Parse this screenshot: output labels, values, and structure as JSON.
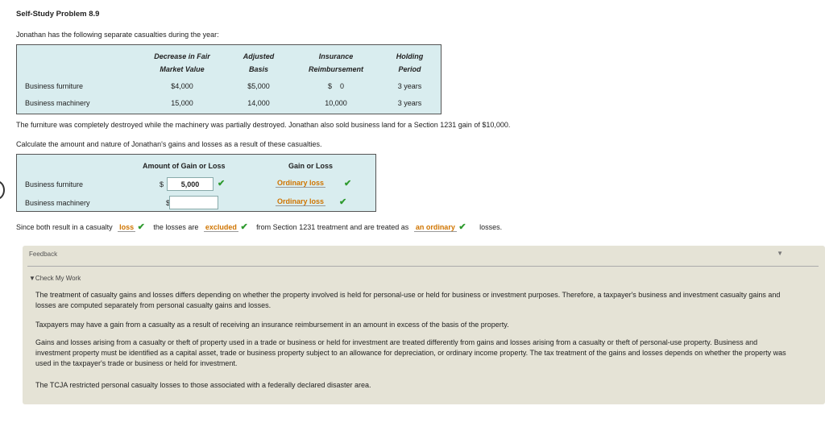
{
  "title": "Self-Study Problem 8.9",
  "intro": "Jonathan has the following separate casualties during the year:",
  "table1": {
    "headers": {
      "decrease_line1": "Decrease in Fair",
      "decrease_line2": "Market Value",
      "adjusted_line1": "Adjusted",
      "adjusted_line2": "Basis",
      "insurance_line1": "Insurance",
      "insurance_line2": "Reimbursement",
      "holding_line1": "Holding",
      "holding_line2": "Period"
    },
    "rows": [
      {
        "label": "Business furniture",
        "decrease": "$4,000",
        "basis": "$5,000",
        "insurance": "$    0",
        "holding": "3 years"
      },
      {
        "label": "Business machinery",
        "decrease": "15,000",
        "basis": "14,000",
        "insurance": "10,000",
        "holding": "3 years"
      }
    ]
  },
  "statement": "The furniture was completely destroyed while the machinery was partially destroyed. Jonathan also sold business land for a Section 1231 gain of $10,000.",
  "instruction": "Calculate the amount and nature of Jonathan's gains and losses as a result of these casualties.",
  "table2": {
    "header_amount": "Amount of Gain or Loss",
    "header_gain": "Gain or Loss",
    "rows": [
      {
        "label": "Business furniture",
        "dollar": "$",
        "value": "5,000",
        "check": "✔",
        "nature": "Ordinary loss",
        "nature_check": "✔"
      },
      {
        "label": "Business machinery",
        "dollar": "$",
        "value": "",
        "check": "",
        "nature": "Ordinary loss",
        "nature_check": "✔"
      }
    ]
  },
  "sentence": {
    "part1": "Since both result in a casualty",
    "choice1": "loss",
    "part2": "the losses are",
    "choice2": "excluded",
    "part3": "from Section 1231 treatment and are treated as",
    "choice3": "an ordinary",
    "part4": "losses.",
    "check": "✔"
  },
  "feedback": {
    "title": "Feedback",
    "toggle": "▼",
    "subheading": "▼Check My Work",
    "paragraphs": [
      "The treatment of casualty gains and losses differs depending on whether the property involved is held for personal-use or held for business or investment purposes. Therefore, a taxpayer's business and investment casualty gains and losses are computed separately from personal casualty gains and losses.",
      "Taxpayers may have a gain from a casualty as a result of receiving an insurance reimbursement in an amount in excess of the basis of the property.",
      "Gains and losses arising from a casualty or theft of property used in a trade or business or held for investment are treated differently from gains and losses arising from a casualty or theft of personal-use property. Business and investment property must be identified as a capital asset, trade or business property subject to an allowance for depreciation, or ordinary income property. The tax treatment of the gains and losses depends on whether the property was used in the taxpayer's trade or business or held for investment.",
      "The TCJA restricted personal casualty losses to those associated with a federally declared disaster area."
    ]
  }
}
